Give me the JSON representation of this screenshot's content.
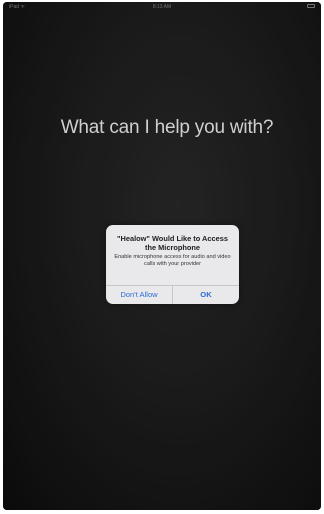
{
  "status_bar": {
    "carrier": "iPad ᯤ",
    "time": "8:13 AM"
  },
  "siri": {
    "prompt": "What can I help you with?"
  },
  "alert": {
    "title": "\"Healow\" Would Like to Access the Microphone",
    "message": "Enable microphone access for audio and video calls with your provider",
    "buttons": {
      "cancel": "Don't Allow",
      "confirm": "OK"
    },
    "button_color": "#2a6fd6"
  }
}
